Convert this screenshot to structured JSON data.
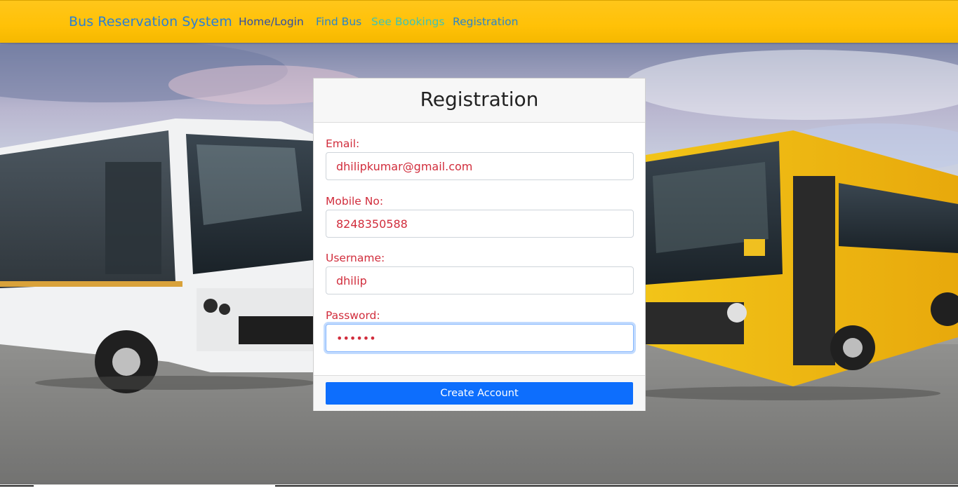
{
  "navbar": {
    "brand": "Bus Reservation System",
    "links": [
      "Home/Login",
      "Find Bus",
      "See Bookings",
      "Registration"
    ]
  },
  "form": {
    "title": "Registration",
    "fields": [
      {
        "label": "Email:",
        "value": "dhilipkumar@gmail.com",
        "type": "text"
      },
      {
        "label": "Mobile No:",
        "value": "8248350588",
        "type": "text"
      },
      {
        "label": "Username:",
        "value": "dhilip",
        "type": "text"
      },
      {
        "label": "Password:",
        "value": "dhilip",
        "type": "password"
      }
    ],
    "submit_label": "Create Account"
  },
  "colors": {
    "navbar": "#ffc107",
    "brand": "#2a7fd4",
    "label": "#d12d3c",
    "button": "#0d6efd"
  }
}
